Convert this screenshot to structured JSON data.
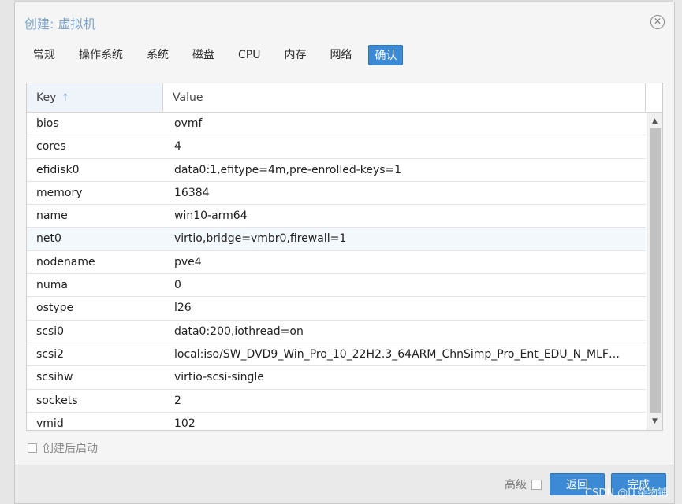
{
  "window": {
    "title": "创建: 虚拟机"
  },
  "tabs": [
    {
      "label": "常规"
    },
    {
      "label": "操作系统"
    },
    {
      "label": "系统"
    },
    {
      "label": "磁盘"
    },
    {
      "label": "CPU"
    },
    {
      "label": "内存"
    },
    {
      "label": "网络"
    },
    {
      "label": "确认",
      "active": true
    }
  ],
  "grid": {
    "columns": {
      "key": "Key",
      "value": "Value"
    },
    "rows": [
      {
        "key": "bios",
        "value": "ovmf"
      },
      {
        "key": "cores",
        "value": "4"
      },
      {
        "key": "efidisk0",
        "value": "data0:1,efitype=4m,pre-enrolled-keys=1"
      },
      {
        "key": "memory",
        "value": "16384"
      },
      {
        "key": "name",
        "value": "win10-arm64"
      },
      {
        "key": "net0",
        "value": "virtio,bridge=vmbr0,firewall=1"
      },
      {
        "key": "nodename",
        "value": "pve4"
      },
      {
        "key": "numa",
        "value": "0"
      },
      {
        "key": "ostype",
        "value": "l26"
      },
      {
        "key": "scsi0",
        "value": "data0:200,iothread=on"
      },
      {
        "key": "scsi2",
        "value": "local:iso/SW_DVD9_Win_Pro_10_22H2.3_64ARM_ChnSimp_Pro_Ent_EDU_N_MLF…"
      },
      {
        "key": "scsihw",
        "value": "virtio-scsi-single"
      },
      {
        "key": "sockets",
        "value": "2"
      },
      {
        "key": "vmid",
        "value": "102"
      }
    ]
  },
  "options": {
    "autostart_label": "创建后启动"
  },
  "footer": {
    "advanced_label": "高级",
    "back_label": "返回",
    "finish_label": "完成"
  },
  "watermark": "CSDN @IT杂物铺"
}
